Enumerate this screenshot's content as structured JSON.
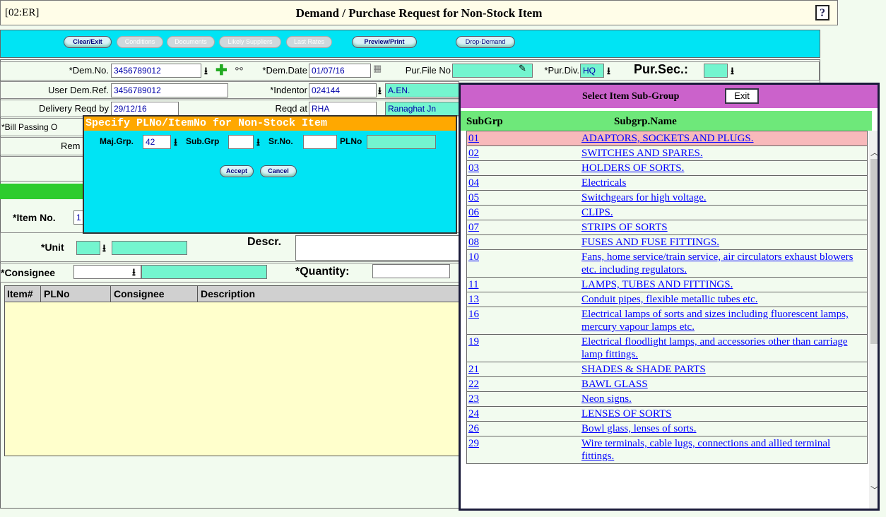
{
  "title_bar": {
    "code": "[02:ER]",
    "title": "Demand / Purchase Request for Non-Stock Item",
    "help_label": "?"
  },
  "toolbar": {
    "buttons": [
      "Clear/Exit",
      "Conditions",
      "Documents",
      "Likely Suppliers",
      "Last Rates",
      "Preview/Print",
      "Drop-Demand"
    ]
  },
  "form": {
    "dem_no_label": "*Dem.No.",
    "dem_no_value": "3456789012",
    "dem_date_label": "*Dem.Date",
    "dem_date_value": "01/07/16",
    "pur_file_label": "Pur.File No",
    "pur_div_label": "*Pur.Div.",
    "pur_div_value": "HQ",
    "pur_sec_label": "Pur.Sec.:",
    "user_ref_label": "User Dem.Ref.",
    "user_ref_value": "3456789012",
    "indentor_label": "*Indentor",
    "indentor_value": "024144",
    "indentor_name": "A.EN.",
    "delivery_label": "Delivery Reqd by",
    "delivery_value": "29/12/16",
    "reqd_at_label": "Reqd at",
    "reqd_at_value": "RHA",
    "reqd_at_name": "Ranaghat Jn",
    "bill_label": "*Bill Passing O",
    "rem_label": "Rem",
    "item_no_label": "*Item No.",
    "item_no_value": "1",
    "unit_label": "*Unit",
    "descr_label": "Descr.",
    "consignee_label": "*Consignee",
    "quantity_label": "*Quantity:",
    "grid_headers": [
      "Item#",
      "PLNo",
      "Consignee",
      "Description"
    ]
  },
  "dialog": {
    "title": "Specify PLNo/ItemNo for Non-Stock Item",
    "maj_grp_label": "Maj.Grp.",
    "maj_grp_value": "42",
    "sub_grp_label": "Sub.Grp",
    "sr_no_label": "Sr.No.",
    "plno_label": "PLNo",
    "accept_label": "Accept",
    "cancel_label": "Cancel"
  },
  "panel": {
    "title": "Select Item Sub-Group",
    "exit_label": "Exit",
    "col1": "SubGrp",
    "col2": "Subgrp.Name",
    "rows": [
      {
        "code": "01",
        "name": "ADAPTORS, SOCKETS AND PLUGS."
      },
      {
        "code": "02",
        "name": "SWITCHES AND SPARES."
      },
      {
        "code": "03",
        "name": "HOLDERS OF SORTS."
      },
      {
        "code": "04",
        "name": "Electricals"
      },
      {
        "code": "05",
        "name": "Switchgears for high voltage."
      },
      {
        "code": "06",
        "name": "CLIPS."
      },
      {
        "code": "07",
        "name": "STRIPS OF SORTS"
      },
      {
        "code": "08",
        "name": "FUSES AND FUSE FITTINGS."
      },
      {
        "code": "10",
        "name": "Fans, home service/train service, air circulators exhaust blowers etc. including regulators."
      },
      {
        "code": "11",
        "name": "LAMPS, TUBES AND FITTINGS."
      },
      {
        "code": "13",
        "name": "Conduit pipes, flexible metallic tubes etc."
      },
      {
        "code": "16",
        "name": "Electrical lamps of sorts and sizes including fluorescent lamps, mercury vapour lamps etc."
      },
      {
        "code": "19",
        "name": "Electrical floodlight lamps, and accessories other than carriage lamp fittings."
      },
      {
        "code": "21",
        "name": "SHADES & SHADE PARTS"
      },
      {
        "code": "22",
        "name": "BAWL GLASS"
      },
      {
        "code": "23",
        "name": "Neon signs."
      },
      {
        "code": "24",
        "name": "LENSES OF SORTS"
      },
      {
        "code": "26",
        "name": "Bowl glass, lenses of sorts."
      },
      {
        "code": "29",
        "name": "Wire terminals, cable lugs, connections and allied terminal fittings."
      }
    ]
  },
  "colors": {
    "toolbar": "#00e4f4",
    "dialog_header": "#ffa800",
    "panel_header": "#cb62cb",
    "column_header": "#6ee87a",
    "selected_row": "#f8b9bb"
  }
}
